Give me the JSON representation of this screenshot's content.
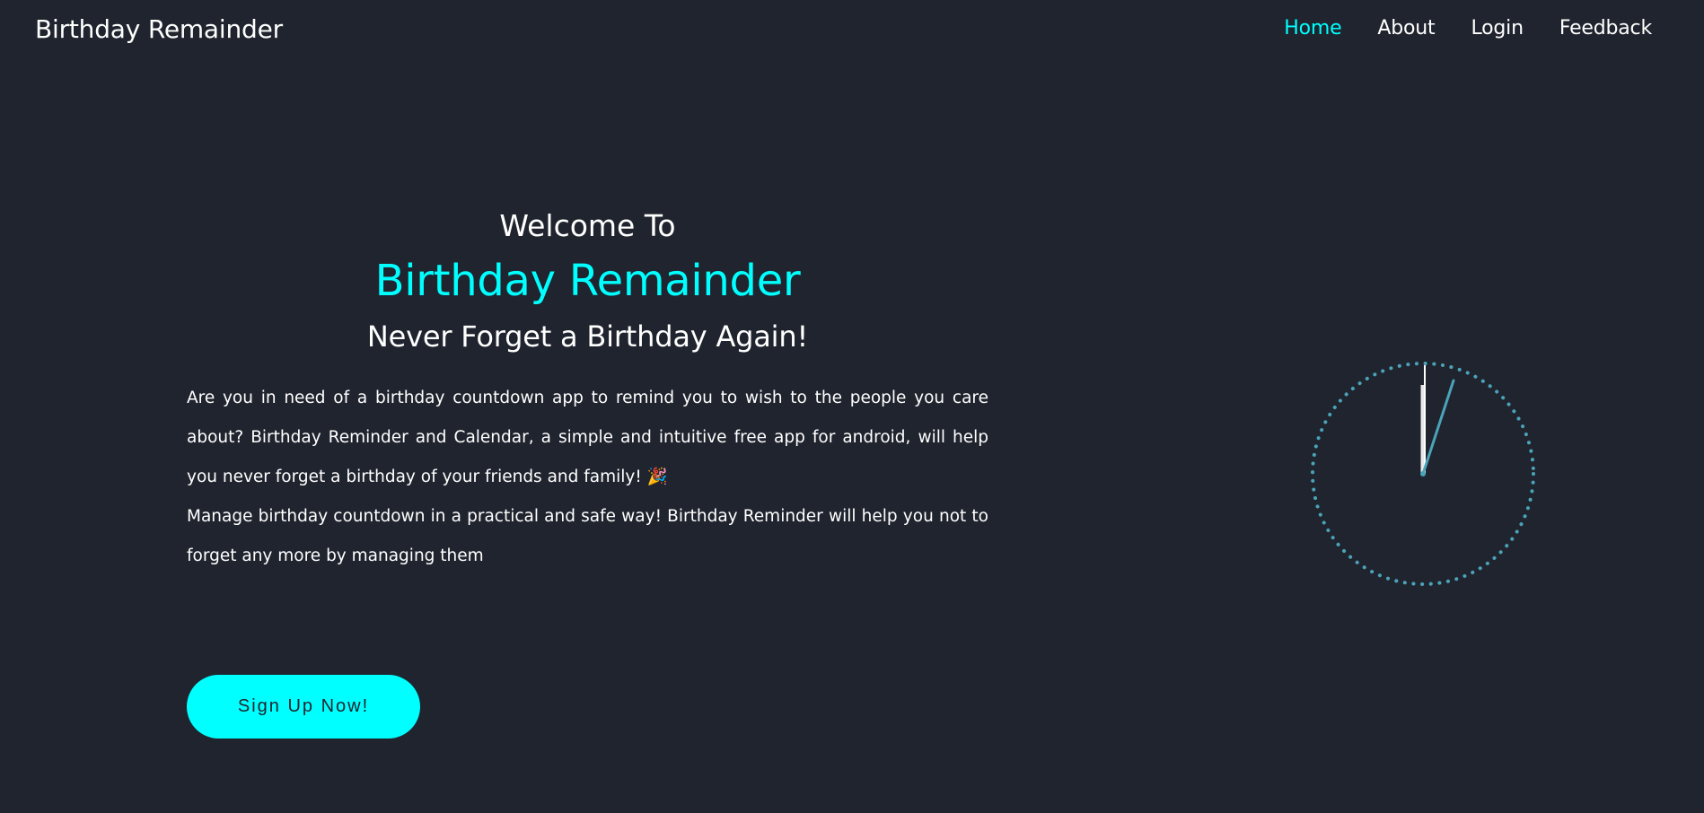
{
  "nav": {
    "brand": "Birthday Remainder",
    "links": [
      {
        "label": "Home",
        "active": true
      },
      {
        "label": "About",
        "active": false
      },
      {
        "label": "Login",
        "active": false
      },
      {
        "label": "Feedback",
        "active": false
      }
    ]
  },
  "hero": {
    "welcome": "Welcome To",
    "app_name": "Birthday Remainder",
    "tagline": "Never Forget a Birthday Again!",
    "paragraph1": "Are you in need of a birthday countdown app to remind you to wish to the people you care about? Birthday Reminder and Calendar, a simple and intuitive free app for android, will help you never forget a birthday of your friends and family! 🎉",
    "paragraph2": "Manage birthday countdown in a practical and safe way! Birthday Reminder will help you not to forget any more by managing them"
  },
  "cta": {
    "label": "Sign Up Now!"
  },
  "clock": {
    "icon": "clock-icon"
  },
  "colors": {
    "background": "#20242e",
    "accent": "#00ffff",
    "clock_dots": "#4aa3b8",
    "text": "#ffffff"
  }
}
